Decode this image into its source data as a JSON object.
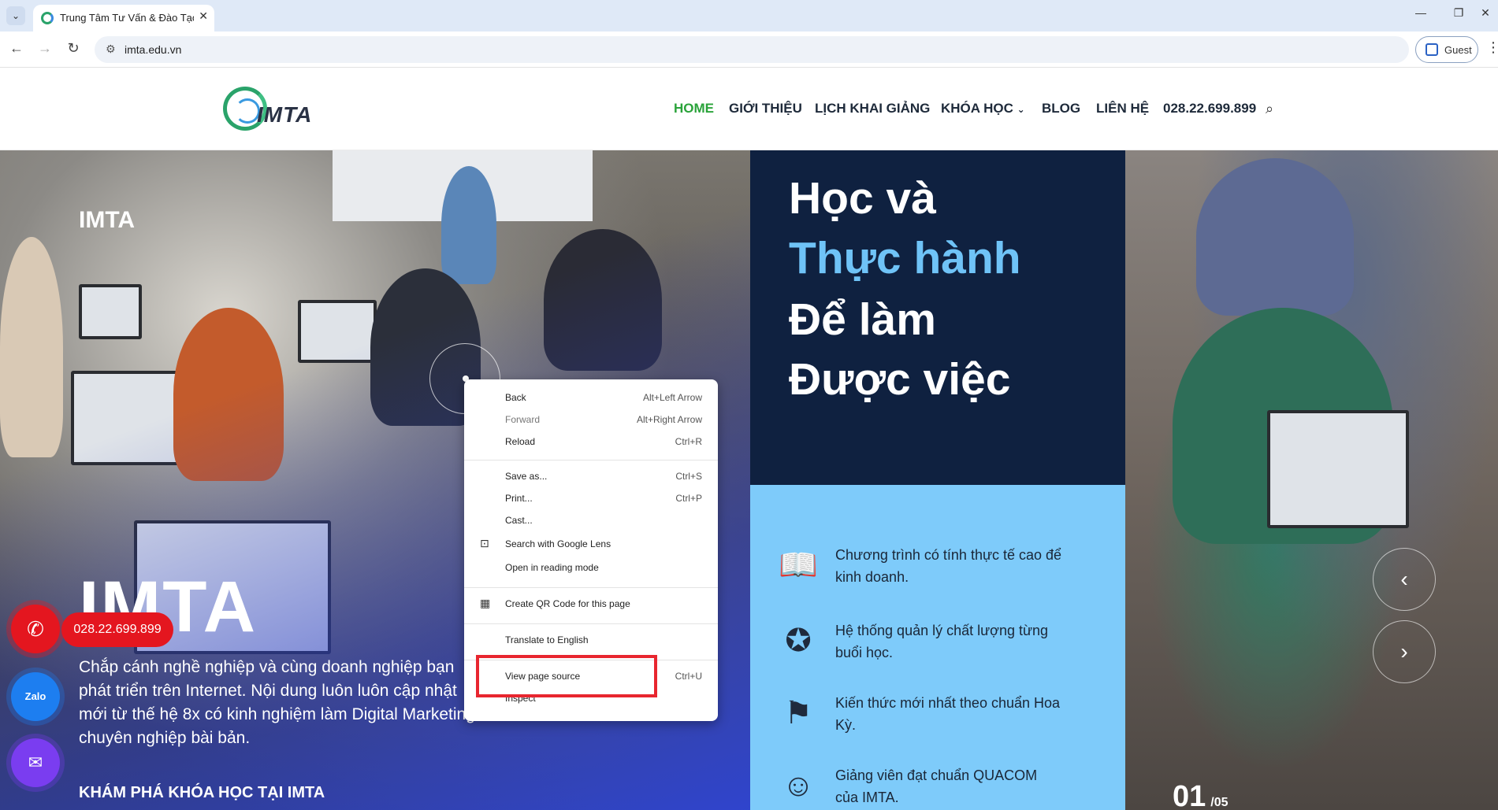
{
  "browser": {
    "tab_title": "Trung Tâm Tư Vấn & Đào Tạo Digital Marketing",
    "url": "imta.edu.vn",
    "profile_label": "Guest"
  },
  "site": {
    "logo_text": "IMTA",
    "nav": [
      "HOME",
      "GIỚI THIỆU",
      "LỊCH KHAI GIẢNG",
      "KHÓA HỌC",
      "BLOG",
      "LIÊN HỆ",
      "028.22.699.899"
    ]
  },
  "hero": {
    "label": "IMTA",
    "big_title": "IMTA",
    "description": "Chắp cánh nghề nghiệp và cùng doanh nghiệp bạn phát triển trên Internet. Nội dung luôn luôn cập nhật mới từ thế hệ 8x có kinh nghiệm làm Digital Marketing chuyên nghiệp bài bản.",
    "cta": "KHÁM PHÁ KHÓA HỌC TẠI IMTA",
    "headline": [
      "Học và",
      "Thực hành",
      "Để làm",
      "Được việc"
    ],
    "features": [
      "Chương trình có tính thực tế cao để kinh doanh.",
      "Hệ thống quản lý chất lượng từng buổi học.",
      "Kiến thức mới nhất theo chuẩn Hoa Kỳ.",
      "Giảng viên đạt chuẩn QUACOM của IMTA."
    ],
    "slide_current": "01",
    "slide_total": "/05"
  },
  "contact": {
    "phone": "028.22.699.899",
    "zalo_label": "Zalo"
  },
  "context_menu": {
    "items": [
      {
        "label": "Back",
        "shortcut": "Alt+Left Arrow"
      },
      {
        "label": "Forward",
        "shortcut": "Alt+Right Arrow"
      },
      {
        "label": "Reload",
        "shortcut": "Ctrl+R"
      },
      {
        "label": "Save as...",
        "shortcut": "Ctrl+S"
      },
      {
        "label": "Print...",
        "shortcut": "Ctrl+P"
      },
      {
        "label": "Cast...",
        "shortcut": ""
      },
      {
        "label": "Search with Google Lens",
        "shortcut": ""
      },
      {
        "label": "Open in reading mode",
        "shortcut": ""
      },
      {
        "label": "Create QR Code for this page",
        "shortcut": ""
      },
      {
        "label": "Translate to English",
        "shortcut": ""
      },
      {
        "label": "View page source",
        "shortcut": "Ctrl+U"
      },
      {
        "label": "Inspect",
        "shortcut": ""
      }
    ]
  },
  "colors": {
    "nav_active": "#2aa33a",
    "dark_panel": "#0f2140",
    "light_panel": "#7ecbfa",
    "headline_accent": "#6fc3f7",
    "call_red": "#e4161f",
    "highlight_box": "#e8262f"
  }
}
